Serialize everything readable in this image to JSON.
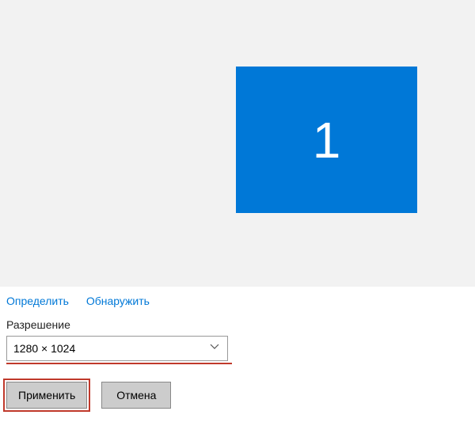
{
  "preview": {
    "monitor_label": "1"
  },
  "links": {
    "identify": "Определить",
    "detect": "Обнаружить"
  },
  "resolution": {
    "label": "Разрешение",
    "value": "1280 × 1024"
  },
  "buttons": {
    "apply": "Применить",
    "cancel": "Отмена"
  }
}
